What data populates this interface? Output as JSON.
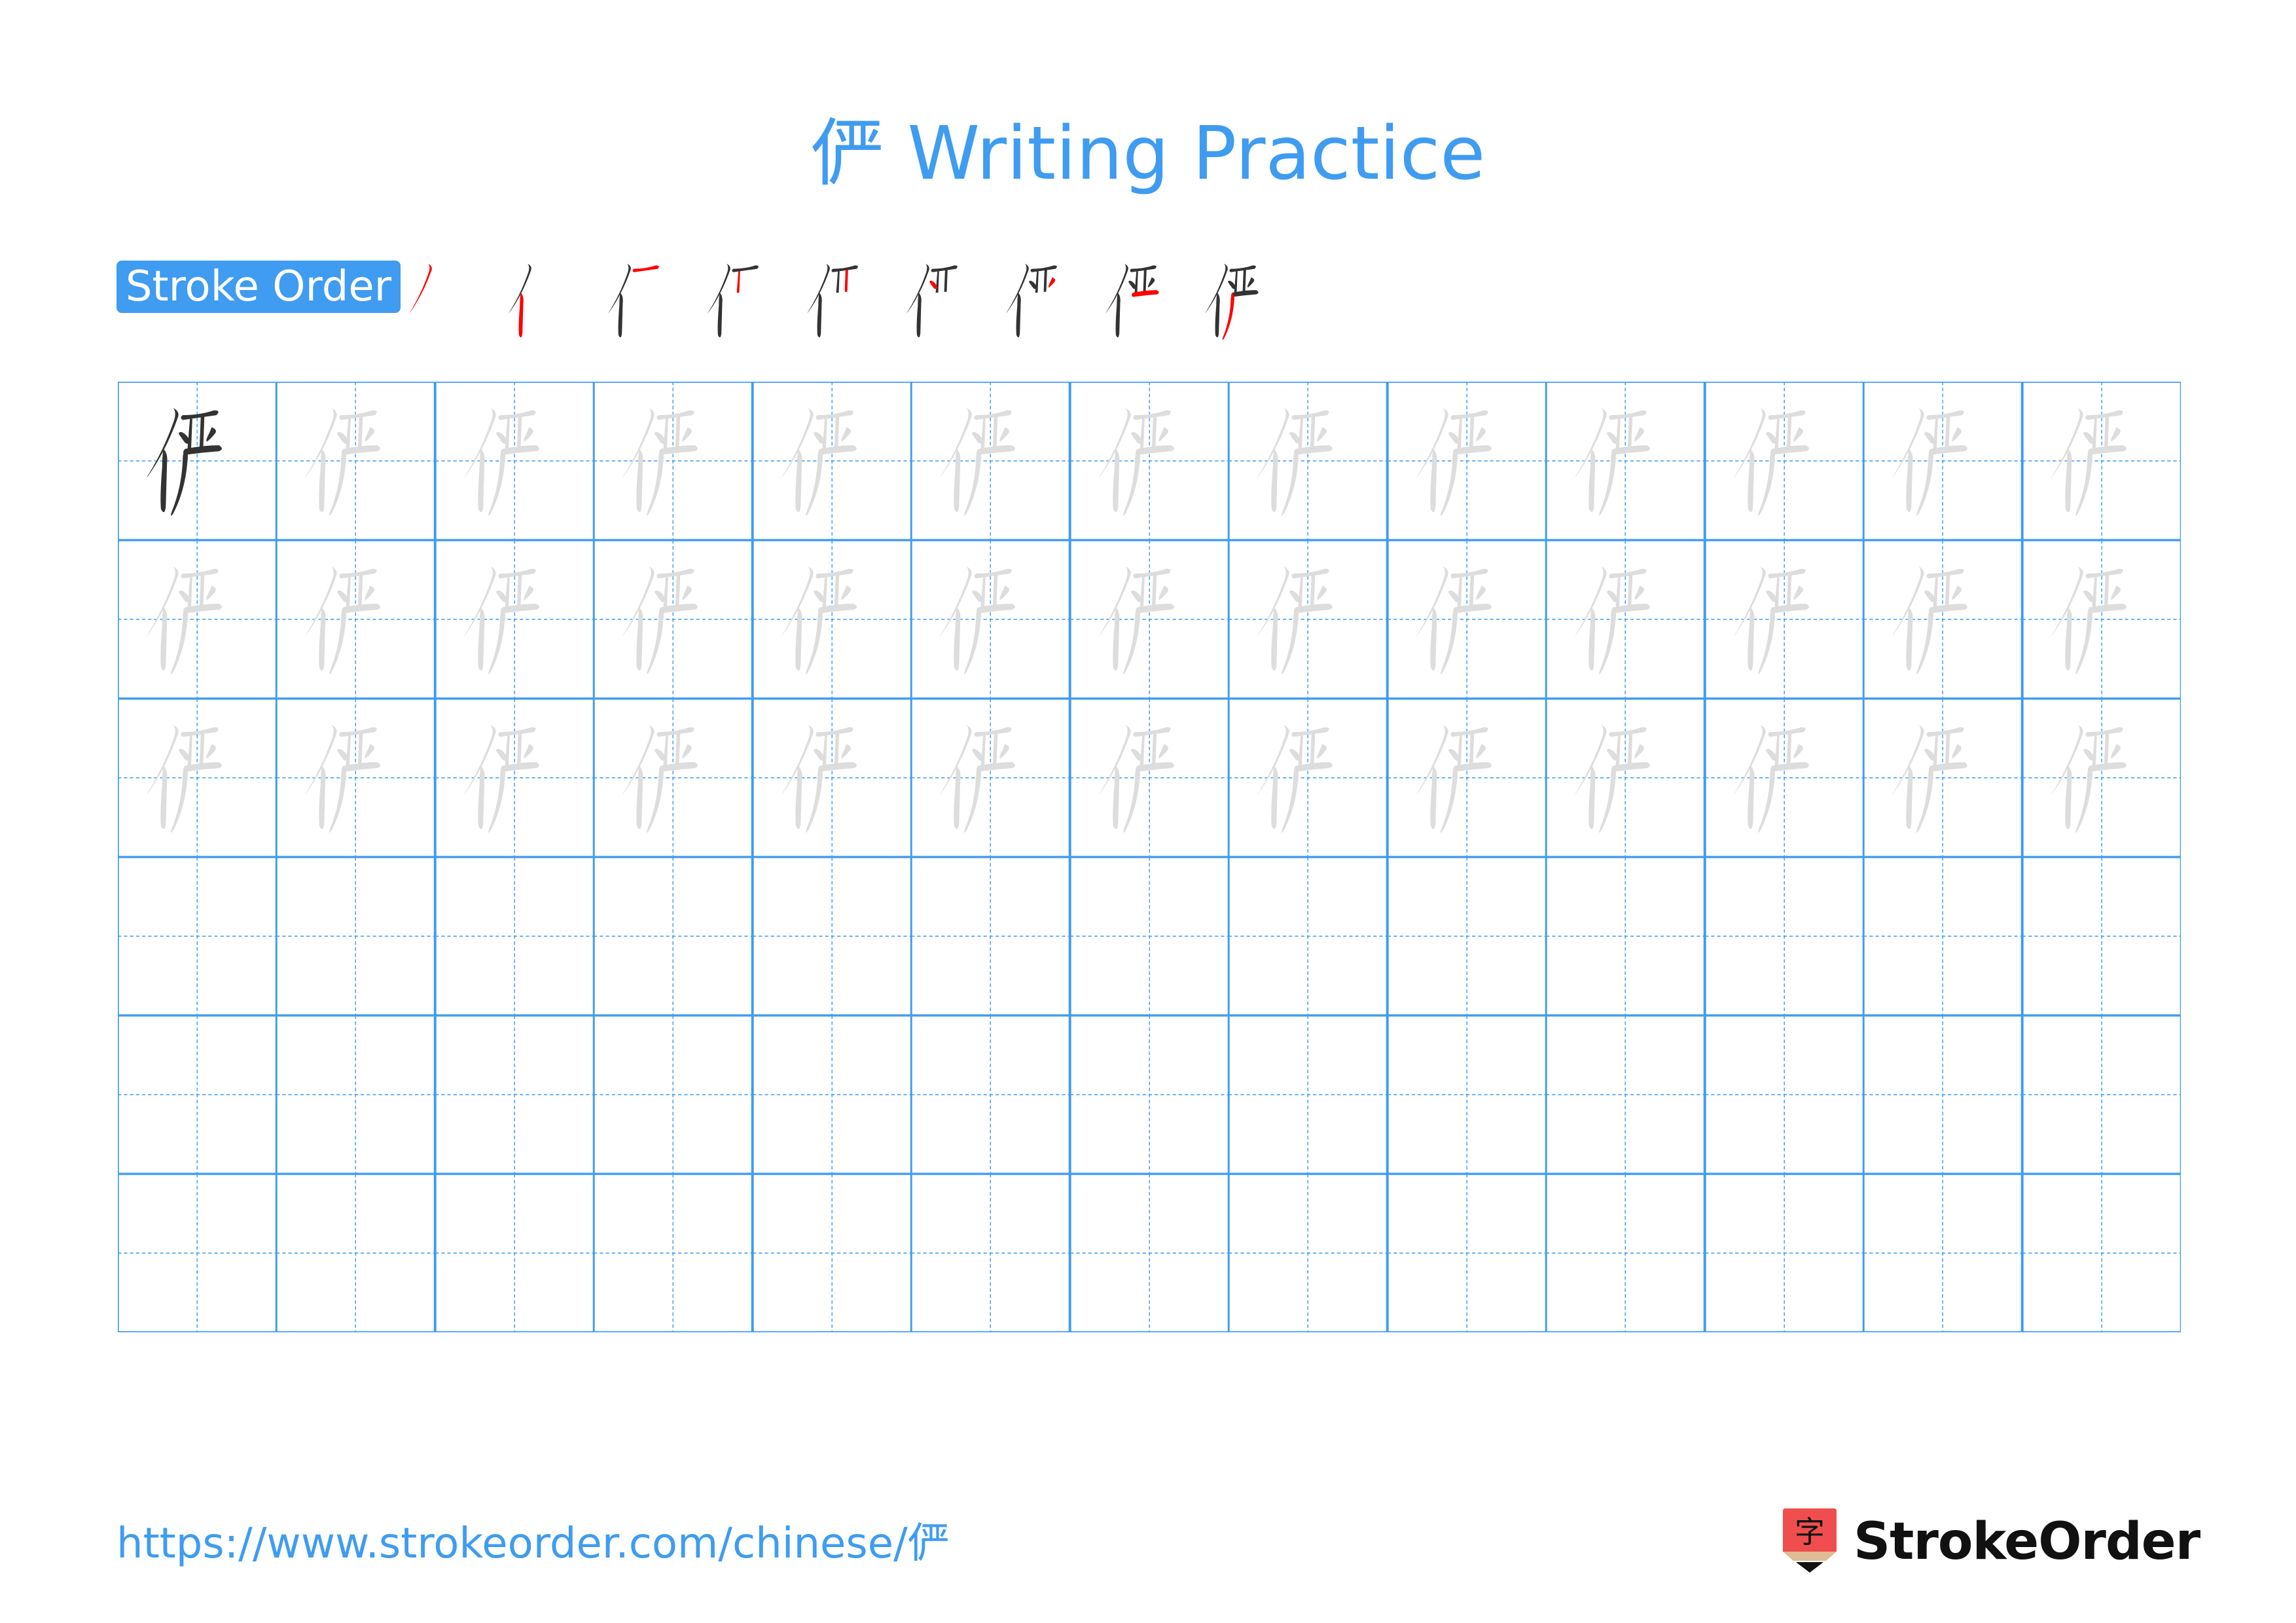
{
  "title": {
    "character": "俨",
    "text": "俨 Writing Practice"
  },
  "stroke_order": {
    "label": "Stroke Order",
    "total_strokes": 9,
    "steps": [
      1,
      2,
      3,
      4,
      5,
      6,
      7,
      8,
      9
    ],
    "current_stroke_color": "#ff0000",
    "previous_stroke_color": "#333333"
  },
  "practice_grid": {
    "rows": 6,
    "columns": 13,
    "model_character": "俨",
    "row_types": [
      "model-then-trace",
      "trace",
      "trace",
      "empty",
      "empty",
      "empty"
    ],
    "grid_color": "#3f9cf0",
    "model_color": "#333333",
    "trace_color": "#dddddd"
  },
  "footer": {
    "url": "https://www.strokeorder.com/chinese/俨",
    "brand_name": "StrokeOrder",
    "logo_glyph": "字",
    "logo_color": "#f04e4e"
  }
}
